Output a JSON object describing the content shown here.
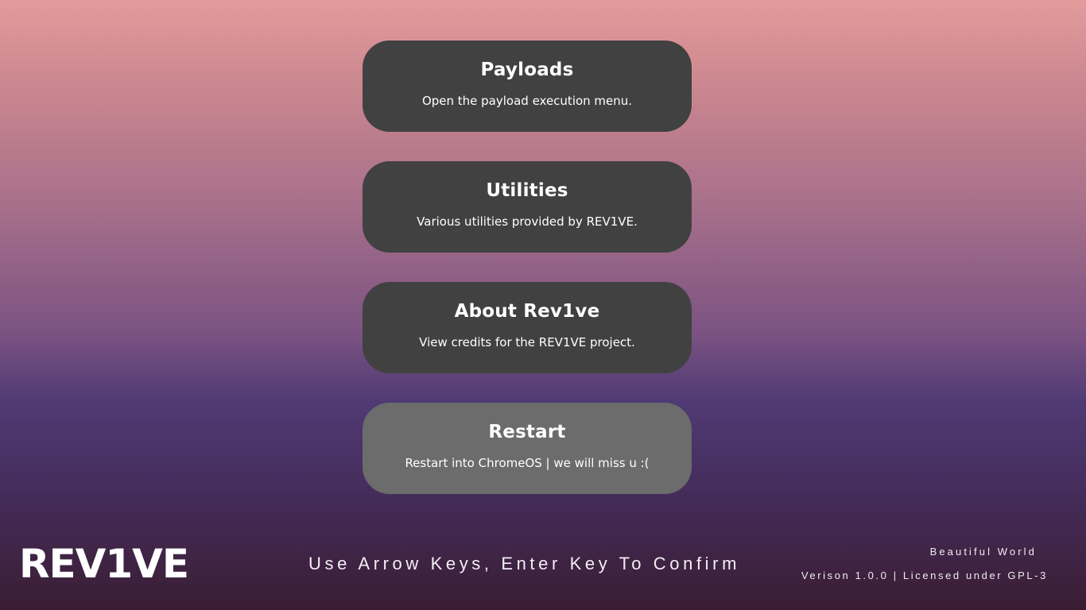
{
  "menu": {
    "items": [
      {
        "title": "Payloads",
        "description": "Open the payload execution menu.",
        "selected": false
      },
      {
        "title": "Utilities",
        "description": "Various utilities provided by REV1VE.",
        "selected": false
      },
      {
        "title": "About Rev1ve",
        "description": "View credits for the REV1VE project.",
        "selected": false
      },
      {
        "title": "Restart",
        "description": "Restart into ChromeOS | we will miss u :(",
        "selected": true
      }
    ]
  },
  "footer": {
    "logo": "REV1VE",
    "hint": "Use Arrow Keys, Enter Key To Confirm",
    "subtitle": "Beautiful World",
    "version": "Verison 1.0.0 | Licensed under GPL-3"
  },
  "colors": {
    "card": "#414141",
    "card_selected": "#6c6c6c",
    "gradient_top": "#e39b9b",
    "gradient_bottom": "#3a1d33"
  }
}
